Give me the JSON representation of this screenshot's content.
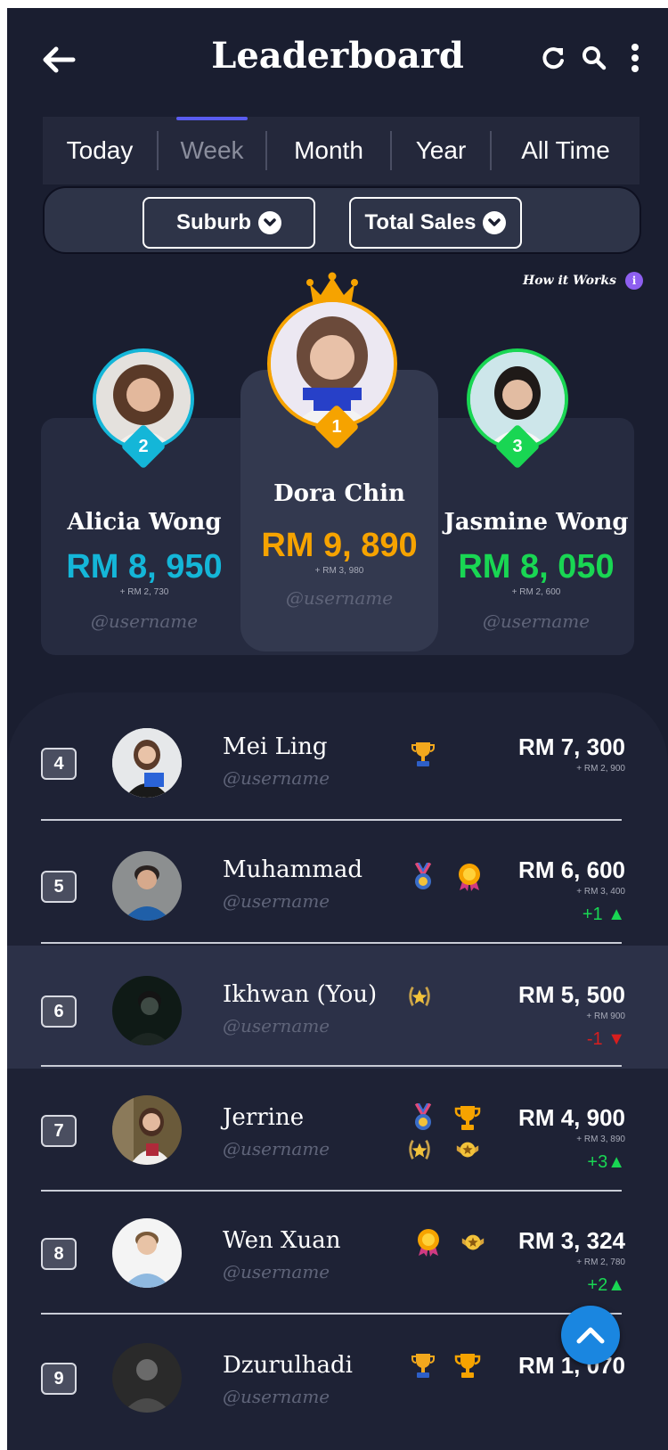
{
  "header": {
    "title": "Leaderboard"
  },
  "tabs": [
    {
      "label": "Today",
      "active": false
    },
    {
      "label": "Week",
      "active": true
    },
    {
      "label": "Month",
      "active": false
    },
    {
      "label": "Year",
      "active": false
    },
    {
      "label": "All Time",
      "active": false
    }
  ],
  "filters": {
    "location": "Suburb",
    "metric": "Total Sales"
  },
  "how_it_works": {
    "label": "How it Works",
    "icon": "i"
  },
  "podium": [
    {
      "rank": "2",
      "name": "Alicia Wong",
      "amount": "RM 8, 950",
      "sub": "+ RM 2, 730",
      "username": "@username",
      "color": "#14b6d8"
    },
    {
      "rank": "1",
      "name": "Dora Chin",
      "amount": "RM 9, 890",
      "sub": "+ RM 3, 980",
      "username": "@username",
      "color": "#f6a300"
    },
    {
      "rank": "3",
      "name": "Jasmine Wong",
      "amount": "RM 8, 050",
      "sub": "+ RM 2, 600",
      "username": "@username",
      "color": "#19d653"
    }
  ],
  "rows": [
    {
      "rank": "4",
      "name": "Mei Ling",
      "username": "@username",
      "amount": "RM 7, 300",
      "sub": "+ RM 2, 900",
      "change": "",
      "badges": [
        "trophy-icon"
      ]
    },
    {
      "rank": "5",
      "name": "Muhammad",
      "username": "@username",
      "amount": "RM 6, 600",
      "sub": "+ RM 3, 400",
      "change": "+1 ▲",
      "badges": [
        "medal-icon",
        "rosette-icon"
      ]
    },
    {
      "rank": "6",
      "name": "Ikhwan (You)",
      "username": "@username",
      "amount": "RM 5, 500",
      "sub": "+ RM 900",
      "change": "-1 ▼",
      "badges": [
        "laurel-star-icon"
      ]
    },
    {
      "rank": "7",
      "name": "Jerrine",
      "username": "@username",
      "amount": "RM 4, 900",
      "sub": "+ RM 3, 890",
      "change": "+3▲",
      "badges": [
        "medal-icon",
        "trophy-icon",
        "laurel-star-icon",
        "winged-badge-icon"
      ]
    },
    {
      "rank": "8",
      "name": "Wen Xuan",
      "username": "@username",
      "amount": "RM 3, 324",
      "sub": "+ RM 2, 780",
      "change": "+2▲",
      "badges": [
        "rosette-icon",
        "winged-badge-icon"
      ]
    },
    {
      "rank": "9",
      "name": "Dzurulhadi",
      "username": "@username",
      "amount": "RM 1, 070",
      "sub": "",
      "change": "",
      "badges": [
        "trophy-icon",
        "trophy-icon"
      ]
    }
  ],
  "colors": {
    "background": "#1a1e30",
    "up": "#19d653",
    "down": "#d81e1e",
    "accent": "#5a5cf0",
    "fab": "#1a86e0"
  }
}
